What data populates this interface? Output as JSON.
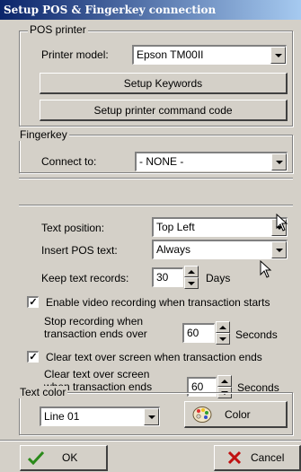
{
  "window": {
    "title": "Setup POS & Fingerkey connection"
  },
  "pos_printer": {
    "group_label": "POS printer",
    "model_label": "Printer model:",
    "model_value": "Epson TM00II",
    "setup_keywords_label": "Setup Keywords",
    "setup_command_label": "Setup printer command code"
  },
  "fingerkey": {
    "group_label": "Fingerkey",
    "connect_label": "Connect to:",
    "connect_value": "- NONE -"
  },
  "text": {
    "position_label": "Text position:",
    "position_value": "Top Left",
    "insert_label": "Insert POS text:",
    "insert_value": "Always",
    "keep_label": "Keep text records:",
    "keep_value": "30",
    "keep_unit": "Days"
  },
  "video": {
    "enable_label": "Enable video recording when transaction starts",
    "enable_checked": "✓",
    "stop_label_line1": "Stop recording when",
    "stop_label_line2": "transaction ends over",
    "stop_value": "60",
    "stop_unit": "Seconds"
  },
  "clear": {
    "enable_label": "Clear text over screen when transaction ends",
    "enable_checked": "✓",
    "after_label_line1": "Clear text over screen",
    "after_label_line2": "when transaction ends",
    "after_value": "60",
    "after_unit": "Seconds"
  },
  "text_color": {
    "group_label": "Text color",
    "line_value": "Line 01",
    "color_button_label": "Color"
  },
  "footer": {
    "ok_label": "OK",
    "cancel_label": "Cancel"
  }
}
